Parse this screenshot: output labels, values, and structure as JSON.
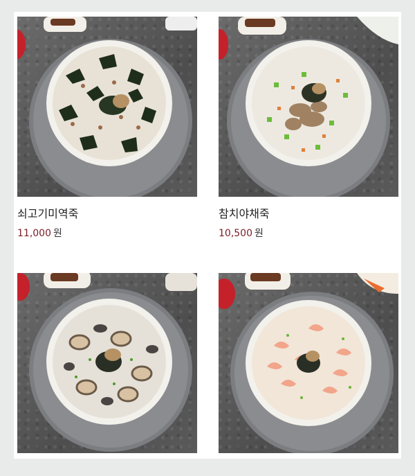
{
  "products": [
    {
      "name": "쇠고기미역죽",
      "price": "11,000",
      "currency": "원",
      "image_alt": "쇠고기미역죽 image",
      "porridge_color": "#e8e2d6",
      "topping_color": "#1f2e1a"
    },
    {
      "name": "참치야채죽",
      "price": "10,500",
      "currency": "원",
      "image_alt": "참치야채죽 image",
      "porridge_color": "#ede9e1",
      "topping_color": "#a08262"
    },
    {
      "name": "",
      "price": "",
      "currency": "",
      "image_alt": "전복버섯죽 image",
      "porridge_color": "#e6e1d8",
      "topping_color": "#6a5a48"
    },
    {
      "name": "",
      "price": "",
      "currency": "",
      "image_alt": "새우죽 image",
      "porridge_color": "#f1e6d8",
      "topping_color": "#f2a58a"
    }
  ]
}
